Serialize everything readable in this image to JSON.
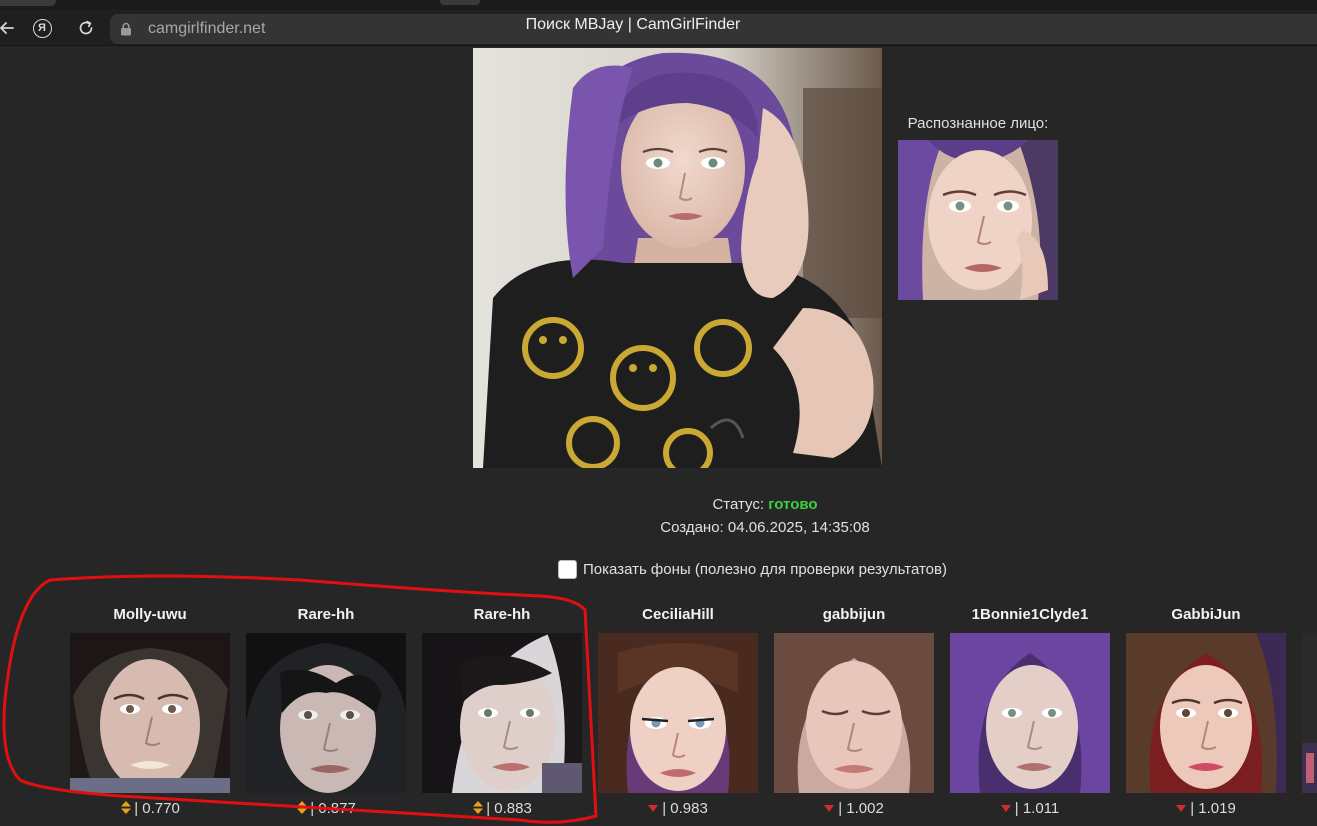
{
  "browser": {
    "url": "camgirlfinder.net",
    "page_title": "Поиск MBJay | CamGirlFinder",
    "yandex_glyph": "Я"
  },
  "search": {
    "face_label": "Распознанное лицо:",
    "status_label": "Статус:",
    "status_value": "готово",
    "created_text": "Создано: 04.06.2025, 14:35:08",
    "show_backgrounds_label": "Показать фоны (полезно для проверки результатов)",
    "show_backgrounds_checked": false
  },
  "results": [
    {
      "name": "Molly-uwu",
      "score": "| 0.770",
      "match_icon": "up-down-arrows-icon",
      "circled": true
    },
    {
      "name": "Rare-hh",
      "score": "| 0.877",
      "match_icon": "up-down-arrows-icon",
      "circled": true
    },
    {
      "name": "Rare-hh",
      "score": "| 0.883",
      "match_icon": "up-down-arrows-icon",
      "circled": true
    },
    {
      "name": "CeciliaHill",
      "score": "| 0.983",
      "match_icon": "down-arrow-icon",
      "circled": false
    },
    {
      "name": "gabbijun",
      "score": "| 1.002",
      "match_icon": "down-arrow-icon",
      "circled": false
    },
    {
      "name": "1Bonnie1Clyde1",
      "score": "| 1.011",
      "match_icon": "down-arrow-icon",
      "circled": false
    },
    {
      "name": "GabbiJun",
      "score": "| 1.019",
      "match_icon": "down-arrow-icon",
      "circled": false
    }
  ],
  "colors": {
    "status_ok": "#3fcf3f",
    "arrow_down": "#d42a2a",
    "arrow_up": "#e8a21a",
    "annotation": "#e01010"
  }
}
